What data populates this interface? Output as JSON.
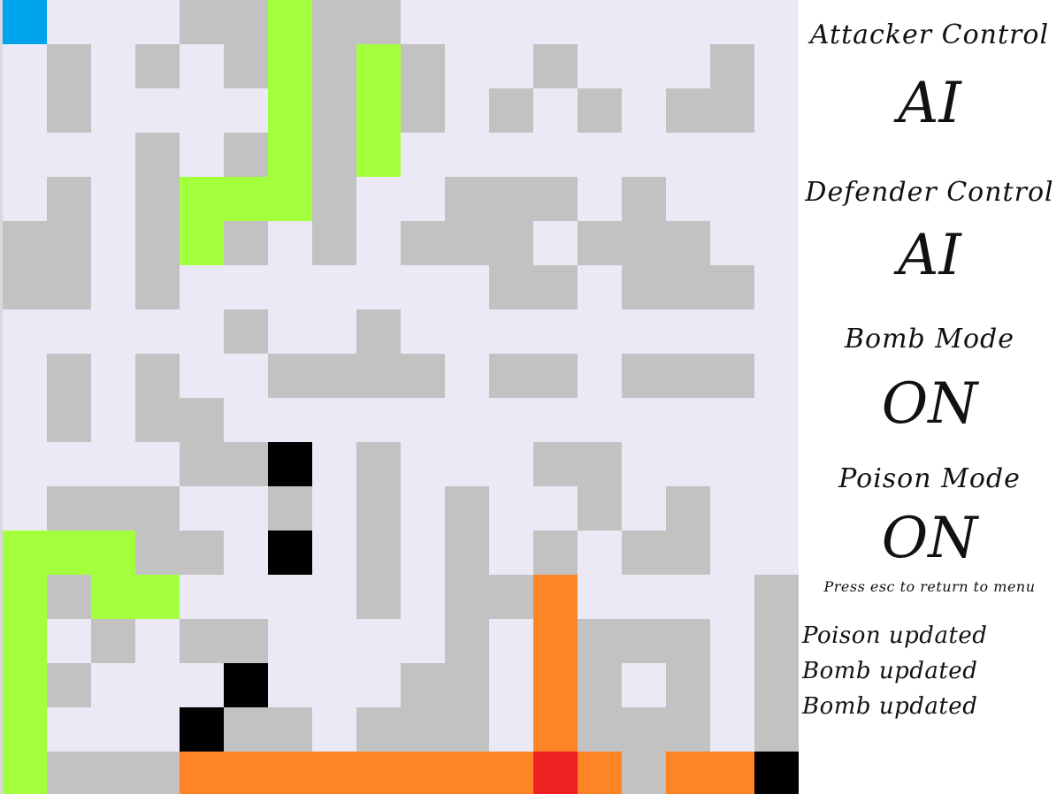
{
  "colors": {
    "floor": "#ece9f7",
    "wall": "#c2c2c2",
    "attacker_path": "#a4ff3c",
    "defender_path": "#ff8425",
    "bomb": "#000000",
    "defender": "#ee2024",
    "attacker": "#00a4ec"
  },
  "grid": {
    "cols": 18,
    "rows": 18,
    "legend": {
      ".": "floor",
      "#": "wall",
      "G": "attacker_path",
      "O": "defender_path",
      "X": "bomb",
      "R": "defender",
      "S": "attacker"
    },
    "cells": [
      "S...##G##.........",
      ".#.#.#G#G#..#...#.",
      ".#....G#G#.#.#.##.",
      "...#.#G#G.........",
      ".#.#GGG#..###.#...",
      "##.#G#.#.###.###..",
      "##.#.......##.###.",
      ".....#..#.........",
      ".#.#..####.##.###.",
      ".#.##.............",
      "....##X.#...##....",
      ".###..#.#.#..#.#..",
      "GGG##.X.#.#.#.##..",
      "G#GG....#.##O....#",
      "G.#.##....#.O###.#",
      "G#...X...##.O#.#.#",
      "G...X##.###.O###.#",
      "G###OOOOOOOORO#OOX"
    ]
  },
  "panel": {
    "attacker_label": "Attacker Control",
    "attacker_value": "AI",
    "defender_label": "Defender Control",
    "defender_value": "AI",
    "bomb_label": "Bomb Mode",
    "bomb_value": "ON",
    "poison_label": "Poison Mode",
    "poison_value": "ON",
    "hint": "Press esc to return to menu",
    "log": [
      "Poison updated",
      "Bomb updated",
      "Bomb updated"
    ]
  }
}
